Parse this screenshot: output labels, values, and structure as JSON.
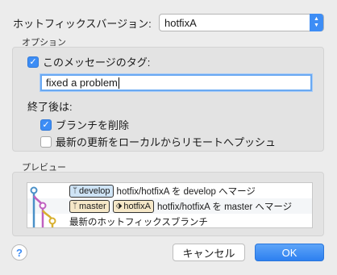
{
  "header": {
    "label": "ホットフィックスバージョン:",
    "selected": "hotfixA"
  },
  "options": {
    "section_label": "オプション",
    "tag_message": {
      "label": "このメッセージのタグ:",
      "checked": true,
      "value": "fixed a problem"
    },
    "after_label": "終了後は:",
    "delete_branch": {
      "label": "ブランチを削除",
      "checked": true
    },
    "push_remote": {
      "label": "最新の更新をローカルからリモートへプッシュ",
      "checked": false
    }
  },
  "preview": {
    "section_label": "プレビュー",
    "rows": [
      {
        "tags": [
          "develop"
        ],
        "text": "hotfix/hotfixA を develop へマージ"
      },
      {
        "tags": [
          "master",
          "hotfixA"
        ],
        "text": "hotfix/hotfixA を master へマージ"
      },
      {
        "tags": [],
        "text": "最新のホットフィックスブランチ"
      }
    ],
    "colors": {
      "line_blue": "#4a90c8",
      "line_magenta": "#c060c0",
      "line_yellow": "#d8b030"
    }
  },
  "footer": {
    "help": "?",
    "cancel": "キャンセル",
    "ok": "OK"
  },
  "colors": {
    "accent": "#3d8df5"
  }
}
